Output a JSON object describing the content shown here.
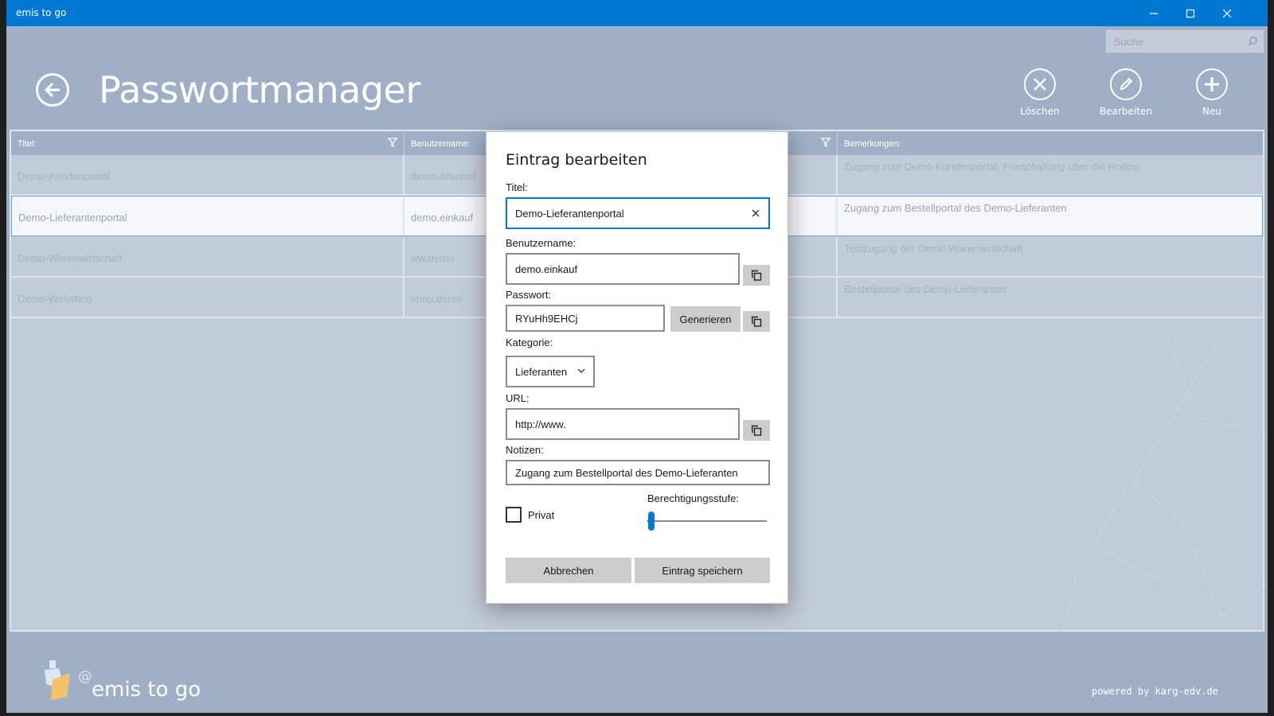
{
  "window": {
    "title": "emis to go"
  },
  "header": {
    "title": "Passwortmanager",
    "search_placeholder": "Suche",
    "commands": {
      "delete": "Löschen",
      "edit": "Bearbeiten",
      "new": "Neu"
    }
  },
  "grid": {
    "columns": {
      "title": "Titel:",
      "username": "Benutzername:",
      "notes": "Bemerkungen:"
    },
    "rows": [
      {
        "title": "Demo-Kundenportal",
        "username": "demo.anwend",
        "notes": "Zugang zum Demo-Kundenportal, Freischaltung über die Hotline"
      },
      {
        "title": "Demo-Lieferantenportal",
        "username": "demo.einkauf",
        "notes": "Zugang zum Bestellportal des Demo-Lieferanten"
      },
      {
        "title": "Demo-Warenwirtschaft",
        "username": "ww.demo",
        "notes": "Testzugang der Demo-Warenwirtschaft"
      },
      {
        "title": "Demo-Webshop",
        "username": "shop.demo",
        "notes": "Bestellportal des Demo-Lieferanten"
      }
    ]
  },
  "dialog": {
    "title": "Eintrag bearbeiten",
    "fields": {
      "title_label": "Titel:",
      "title_value": "Demo-Lieferantenportal",
      "username_label": "Benutzername:",
      "username_value": "demo.einkauf",
      "password_label": "Passwort:",
      "password_value": "RYuHh9EHCj",
      "category_label": "Kategorie:",
      "category_value": "Lieferanten",
      "url_label": "URL:",
      "url_value": "http://www.",
      "notes_label": "Notizen:",
      "notes_value": "Zugang zum Bestellportal des Demo-Lieferanten",
      "private_label": "Privat",
      "private_checked": false,
      "permission_label": "Berechtigungsstufe:",
      "permission_level": 0.03
    },
    "buttons": {
      "generate": "Generieren",
      "cancel": "Abbrechen",
      "save": "Eintrag speichern"
    }
  },
  "footer": {
    "brand": "emis to go",
    "powered": "powered by karg-edv.de"
  },
  "colors": {
    "accent": "#0078d4",
    "background": "#9fb0c6",
    "grid": "#c2ccd8"
  }
}
